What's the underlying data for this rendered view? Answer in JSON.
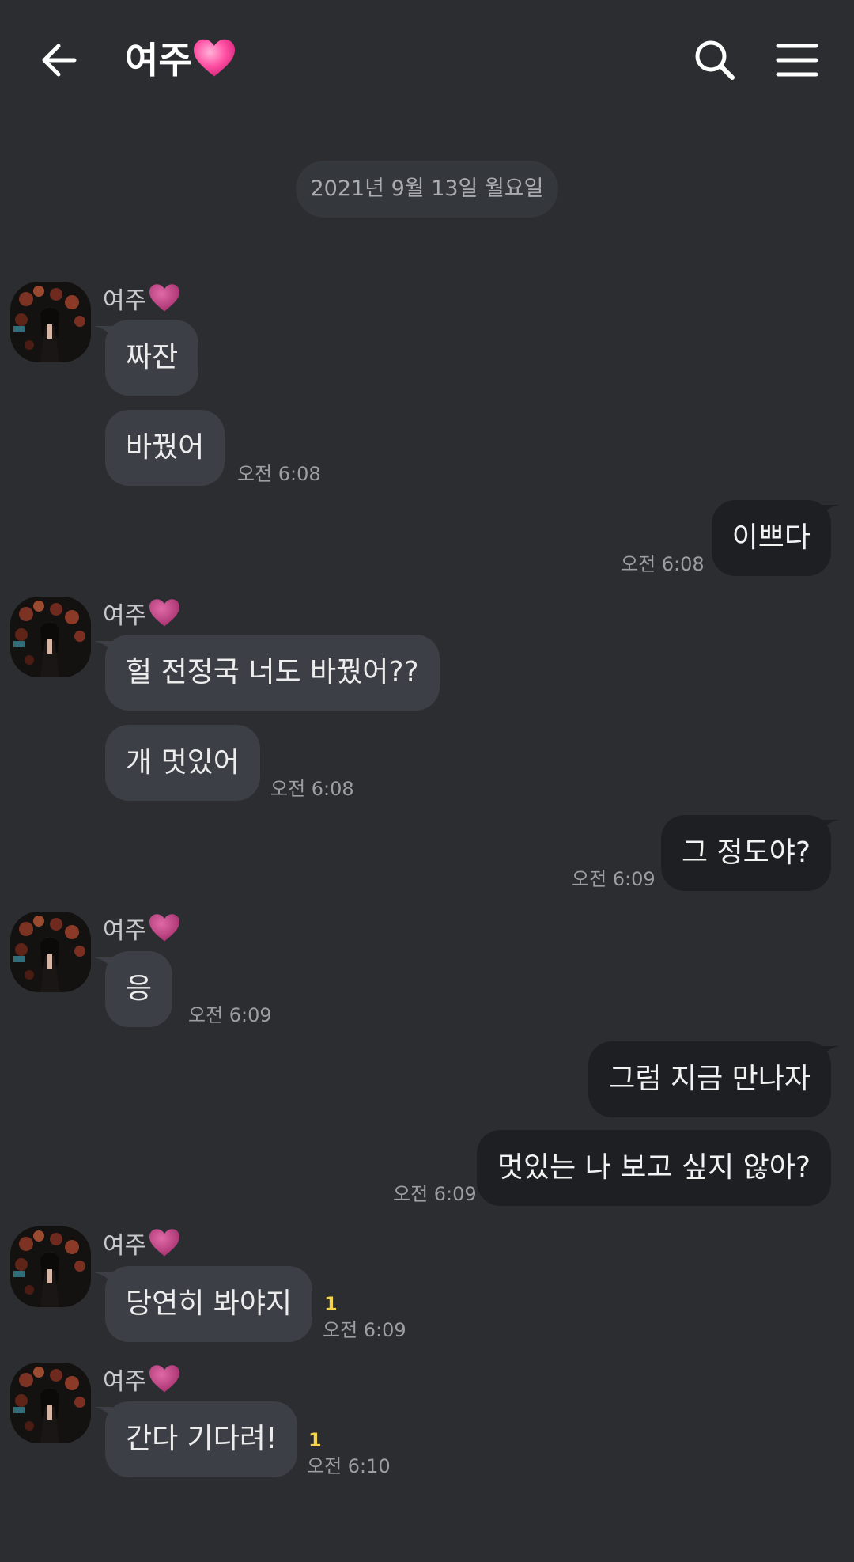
{
  "header": {
    "title": "여주",
    "heart_icon": "pink-heart-icon",
    "back_icon": "arrow-left-icon",
    "search_icon": "search-icon",
    "menu_icon": "hamburger-menu-icon"
  },
  "date_divider": "2021년 9월 13일 월요일",
  "contact": {
    "name": "여주"
  },
  "messages": [
    {
      "text": "짜잔"
    },
    {
      "text": "바꿨어",
      "time": "오전 6:08"
    },
    {
      "text": "이쁘다",
      "time": "오전 6:08"
    },
    {
      "text": "헐 전정국 너도 바꿨어??"
    },
    {
      "text": "개 멋있어",
      "time": "오전 6:08"
    },
    {
      "text": "그 정도야?",
      "time": "오전 6:09"
    },
    {
      "text": "응",
      "time": "오전 6:09"
    },
    {
      "text": "그럼 지금 만나자"
    },
    {
      "text": "멋있는 나 보고 싶지 않아?",
      "time": "오전 6:09"
    },
    {
      "text": "당연히 봐야지",
      "time": "오전 6:09",
      "unread": "1"
    },
    {
      "text": "간다 기다려!",
      "time": "오전 6:10",
      "unread": "1"
    }
  ],
  "colors": {
    "background": "#2b2d31",
    "incoming_bubble": "#3c3f45",
    "outgoing_bubble": "#1e1f22",
    "unread_count": "#f3d44b",
    "heart": "#ff4fa3"
  }
}
